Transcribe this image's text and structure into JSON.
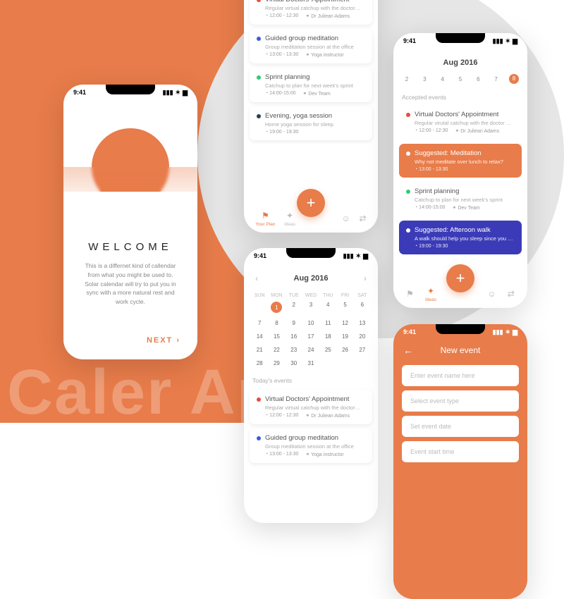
{
  "bgText": "Caler\nApp",
  "statusTime": "9:41",
  "welcome": {
    "title": "WELCOME",
    "body": "This is a differnet kind of callendar from what you might be used to. Solar calendar will try to put you in sync with a more natural rest and work cycle.",
    "next": "NEXT ›"
  },
  "events": [
    {
      "color": "red",
      "title": "Virtual Doctors' Appointment",
      "desc": "Regular virtual catchup with the doctor…",
      "time": "12:00 - 12:30",
      "who": "Dr Juliean Adams"
    },
    {
      "color": "blue",
      "title": "Guided group meditation",
      "desc": "Group meditation session at the office",
      "time": "13:00 - 13:30",
      "who": "Yoga instructor"
    },
    {
      "color": "green",
      "title": "Sprint planning",
      "desc": "Catchup to plan for next week's sprint",
      "time": "14:00-15:00",
      "who": "Dev Team"
    },
    {
      "color": "navy",
      "title": "Evening, yoga session",
      "desc": "Home yoga session for sleep.",
      "time": "19:00 - 19:30",
      "who": ""
    }
  ],
  "tabs": [
    "Your Plan",
    "Ideas",
    "",
    "",
    ""
  ],
  "month": {
    "title": "Aug 2016",
    "weekdays": [
      "SUN",
      "MON",
      "TUE",
      "WED",
      "THU",
      "FRI",
      "SAT"
    ],
    "selected": 1,
    "todaysLabel": "Today's events"
  },
  "week": {
    "title": "Aug 2016",
    "days": [
      "2",
      "3",
      "4",
      "5",
      "6",
      "7",
      "8"
    ],
    "selected": "8",
    "acceptedLabel": "Accepted events",
    "items": [
      {
        "type": "plain",
        "color": "red",
        "title": "Virtual Doctors' Appointment",
        "desc": "Regular virutal catchup with the doctor …",
        "time": "12:00 - 12:30",
        "who": "Dr Juliean Adams"
      },
      {
        "type": "sugg",
        "bg": "orange",
        "title": "Suggested: Meditation",
        "desc": "Why not meditate over lunch to relax?",
        "time": "13:00 - 13:30"
      },
      {
        "type": "plain",
        "color": "green",
        "title": "Sprint planning",
        "desc": "Catchup to plan for next week's sprint",
        "time": "14:00-15:00",
        "who": "Dev Team"
      },
      {
        "type": "sugg",
        "bg": "navy",
        "title": "Suggested: Afteroon walk",
        "desc": "A walk should help you sleep since you …",
        "time": "19:00 - 19:30"
      }
    ]
  },
  "newEvent": {
    "title": "New event",
    "fields": [
      "Enter event name here",
      "Select event type",
      "Set event date",
      "Event start time"
    ]
  }
}
